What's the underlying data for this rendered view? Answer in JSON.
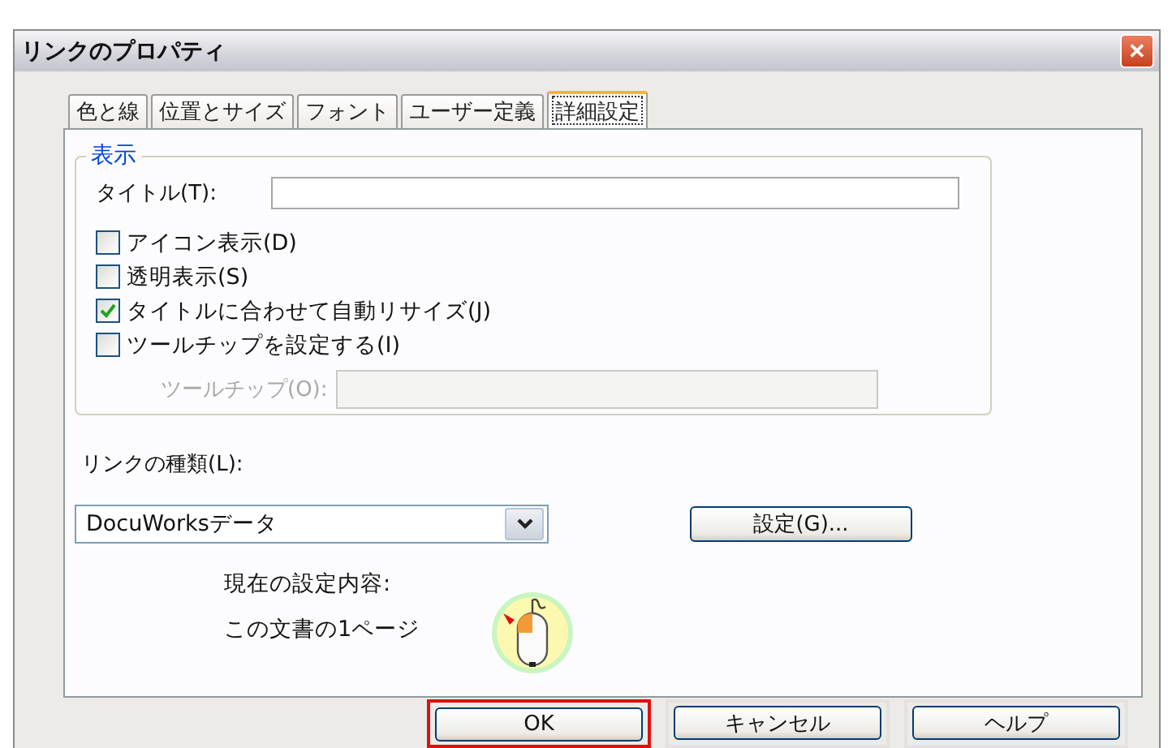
{
  "window": {
    "title": "リンクのプロパティ",
    "close": "✕"
  },
  "tabs": [
    {
      "label": "色と線",
      "selected": false
    },
    {
      "label": "位置とサイズ",
      "selected": false
    },
    {
      "label": "フォント",
      "selected": false
    },
    {
      "label": "ユーザー定義",
      "selected": false
    },
    {
      "label": "詳細設定",
      "selected": true
    }
  ],
  "display_group": {
    "legend": "表示",
    "title_label": "タイトル(T):",
    "checkboxes": [
      {
        "label": "アイコン表示(D)",
        "checked": false
      },
      {
        "label": "透明表示(S)",
        "checked": false
      },
      {
        "label": "タイトルに合わせて自動リサイズ(J)",
        "checked": true
      },
      {
        "label": "ツールチップを設定する(I)",
        "checked": false
      }
    ],
    "tooltip": {
      "label": "ツールチップ(O):",
      "disabled": true
    }
  },
  "link_type": {
    "label": "リンクの種類(L):",
    "value": "DocuWorksデータ",
    "settings_button": "設定(G)...",
    "current_label": "現在の設定内容:",
    "current_value": "この文書の1ページ"
  },
  "buttons": [
    {
      "label": "OK",
      "highlighted": true
    },
    {
      "label": "キャンセル",
      "highlighted": false
    },
    {
      "label": "ヘルプ",
      "highlighted": false
    }
  ]
}
